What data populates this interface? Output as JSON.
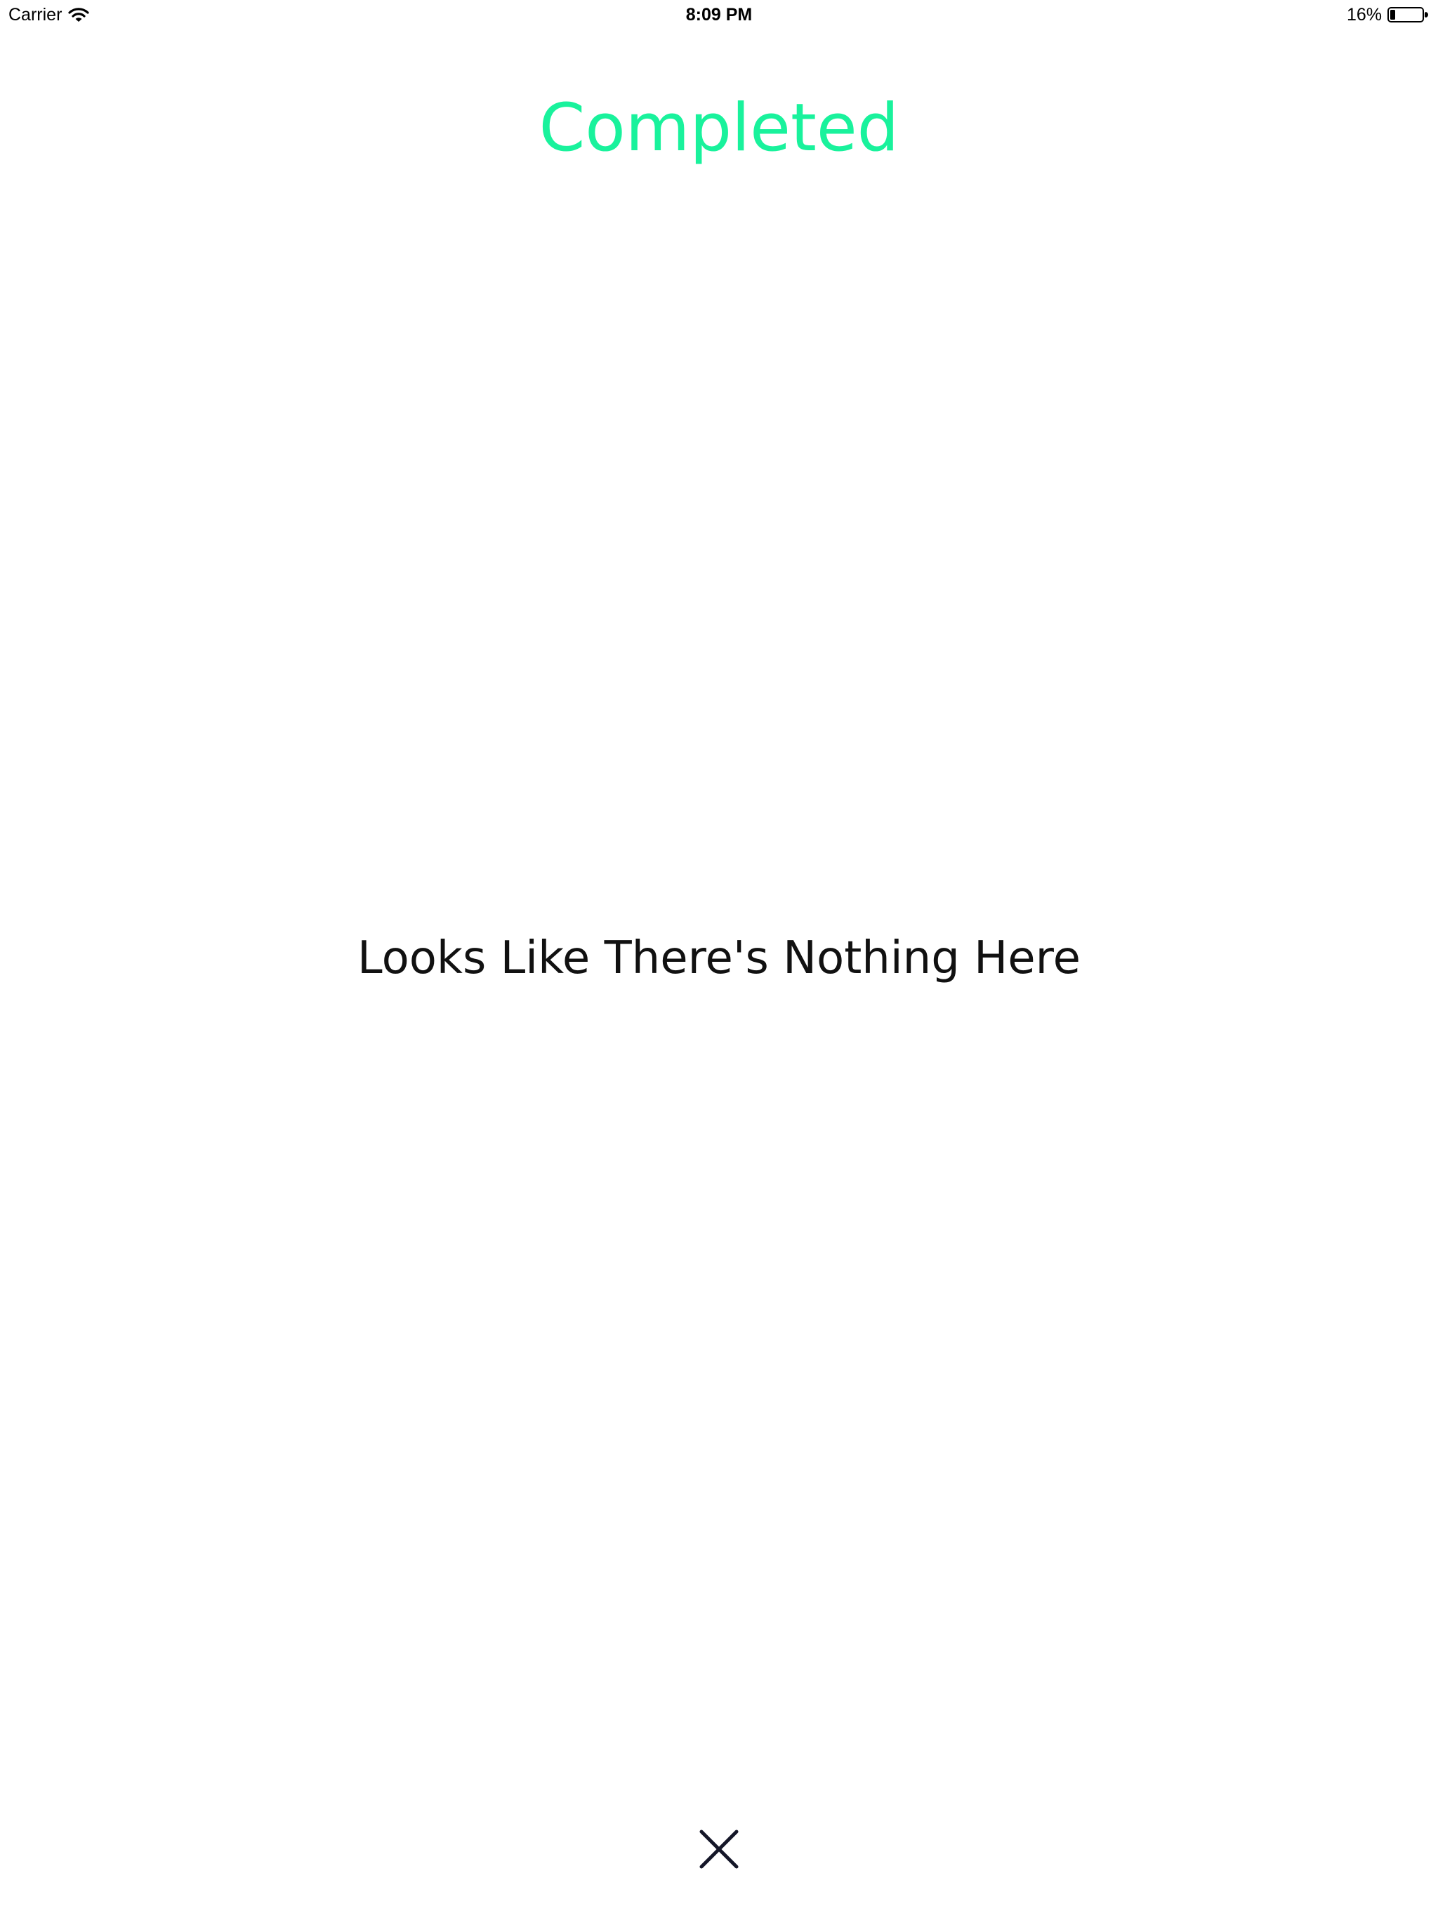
{
  "status_bar": {
    "carrier": "Carrier",
    "time": "8:09 PM",
    "battery_percent": "16%",
    "battery_level": 0.16,
    "wifi_icon": "wifi-icon",
    "battery_icon": "battery-icon"
  },
  "header": {
    "title": "Completed",
    "title_color": "#19f29c"
  },
  "main": {
    "empty_message": "Looks Like There's Nothing Here"
  },
  "footer": {
    "close_icon": "close-icon"
  }
}
